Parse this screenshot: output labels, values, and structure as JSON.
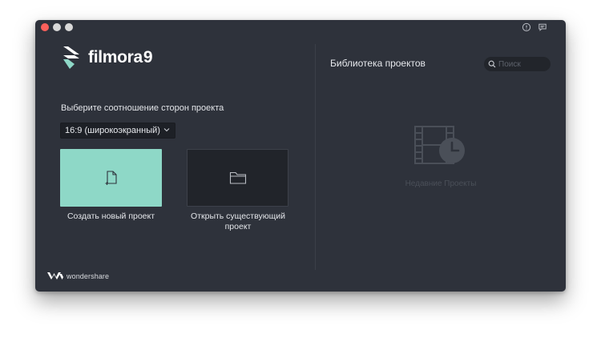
{
  "app": {
    "logo_text": "filmora",
    "logo_version": "9",
    "brand_footer": "wondershare"
  },
  "start": {
    "aspect_label": "Выберите соотношение сторон проекта",
    "aspect_selected": "16:9 (широкоэкранный)",
    "new_project_label": "Создать новый проект",
    "open_project_label": "Открыть существующий проект"
  },
  "library": {
    "title": "Библиотека проектов",
    "search_placeholder": "Поиск",
    "empty_label": "Недавние Проекты"
  },
  "colors": {
    "window_bg": "#2e323b",
    "accent_teal": "#8ed8c7",
    "close_red": "#fc605b"
  },
  "icons": [
    "help-icon",
    "feedback-icon",
    "new-file-icon",
    "folder-icon",
    "search-icon",
    "recent-projects-icon",
    "chevron-down-icon"
  ]
}
